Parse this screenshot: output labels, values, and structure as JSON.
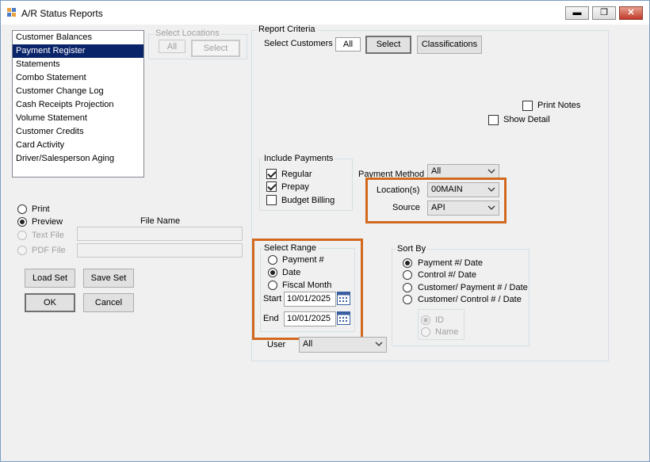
{
  "window": {
    "title": "A/R Status Reports",
    "minimize": "▬",
    "restore": "❐",
    "close": "✕"
  },
  "report_list": [
    "Customer Balances",
    "Payment Register",
    "Statements",
    "Combo Statement",
    "Customer Change Log",
    "Cash Receipts Projection",
    "Volume Statement",
    "Customer Credits",
    "Card Activity",
    "Driver/Salesperson Aging"
  ],
  "selected_report_index": 1,
  "select_locations": {
    "label": "Select Locations",
    "all_value": "All",
    "select_button": "Select"
  },
  "output": {
    "print": "Print",
    "preview": "Preview",
    "text_file": "Text File",
    "pdf_file": "PDF File",
    "file_name_label": "File Name",
    "selected": "preview"
  },
  "buttons": {
    "load_set": "Load Set",
    "save_set": "Save Set",
    "ok": "OK",
    "cancel": "Cancel"
  },
  "report_criteria": {
    "label": "Report Criteria",
    "select_customers_label": "Select Customers",
    "customers_value": "All",
    "select_button": "Select",
    "classifications_button": "Classifications",
    "print_notes": "Print Notes",
    "show_detail": "Show Detail"
  },
  "include_payments": {
    "label": "Include Payments",
    "regular": "Regular",
    "prepay": "Prepay",
    "budget_billing": "Budget Billing",
    "regular_checked": true,
    "prepay_checked": true,
    "budget_billing_checked": false
  },
  "payment_method": {
    "label": "Payment Method",
    "value": "All"
  },
  "locations": {
    "label": "Location(s)",
    "value": "00MAIN"
  },
  "source": {
    "label": "Source",
    "value": "API"
  },
  "select_range": {
    "label": "Select Range",
    "payment_no": "Payment #",
    "date": "Date",
    "fiscal_month": "Fiscal Month",
    "selected": "date",
    "start_label": "Start",
    "start_value": "10/01/2025",
    "end_label": "End",
    "end_value": "10/01/2025"
  },
  "user": {
    "label": "User",
    "value": "All"
  },
  "sort_by": {
    "label": "Sort By",
    "options": [
      "Payment #/ Date",
      "Control #/ Date",
      "Customer/ Payment # / Date",
      "Customer/ Control # / Date"
    ],
    "selected_index": 0,
    "sub_options": [
      "ID",
      "Name"
    ]
  },
  "colors": {
    "highlight": "#d2691e",
    "selection": "#0a246a"
  }
}
